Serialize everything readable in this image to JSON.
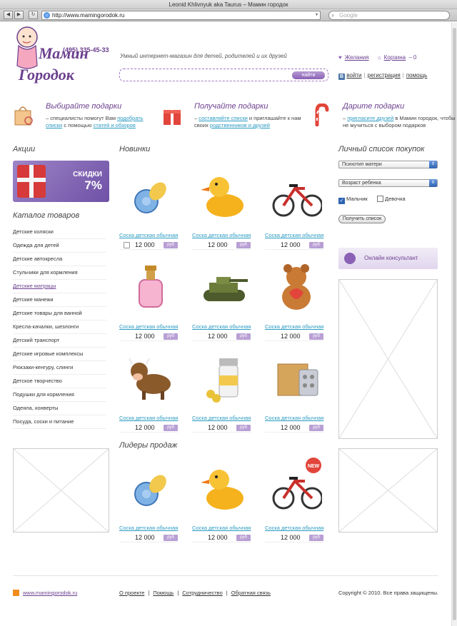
{
  "browser": {
    "title": "Leonid Khlivnyuk aka Taurus – Мамин городок",
    "url": "http://www.mamingorodok.ru",
    "search_placeholder": "Google"
  },
  "header": {
    "logo_line1": "Мамин",
    "logo_line2": "Городок",
    "phone": "(495) 335-45-33",
    "slogan": "Умный интернет-магазин для детей, родителей и их друзей",
    "search_button": "найти",
    "wishlist": "Желания",
    "cart": "Корзина",
    "cart_sep": "–",
    "cart_count": "0",
    "login": "войти",
    "register": "регистрация",
    "help": "помощь"
  },
  "features": [
    {
      "title": "Выбирайте подарки",
      "text_a": "– специалисты помогут Вам ",
      "link_a": "подобрать списки",
      "text_b": " с помощью ",
      "link_b": "статей и обзоров"
    },
    {
      "title": "Получайте подарки",
      "text_a": "– ",
      "link_a": "составляйте списки",
      "text_b": " и приглашайте к нам своих ",
      "link_b": "родственников и друзей"
    },
    {
      "title": "Дарите подарки",
      "text_a": "– ",
      "link_a": "пригласите друзей",
      "text_b": " в Мамин городок, чтобы не мучиться с выбором подарков",
      "link_b": ""
    }
  ],
  "left": {
    "promo_title": "Акции",
    "promo_word": "СКИДКИ",
    "promo_percent": "7%",
    "catalog_title": "Каталог товаров",
    "catalog": [
      "Детские коляски",
      "Одежда для детей",
      "Детские автокресла",
      "Стульчики для кормления",
      "Детские матрацы",
      "Детские манежи",
      "Детские товары для ванной",
      "Кресла-качалки, шезлонги",
      "Детский транспорт",
      "Детские игровые комплексы",
      "Рюкзаки-кенгуру, слинги",
      "Детское творчество",
      "Подушки для кормления",
      "Одеяла, конверты",
      "Посуда, соски и питание"
    ]
  },
  "new_title": "Новинки",
  "leaders_title": "Лидеры продаж",
  "product_name": "Соска детская обычная",
  "product_price": "12 000",
  "product_currency": "руб",
  "new_badge": "NEW",
  "products_new": [
    "pacifier-icon",
    "duck-icon",
    "bicycle-icon",
    "perfume-icon",
    "tank-icon",
    "teddy-bear-icon",
    "cow-icon",
    "pill-bottle-icon",
    "medicine-box-icon"
  ],
  "products_leaders": [
    "pacifier-icon",
    "duck-icon",
    "bicycle-icon"
  ],
  "right": {
    "title": "Личный список покупок",
    "select1": "Психотип матери",
    "select2": "Возраст ребенка",
    "boy": "Мальчик",
    "girl": "Девочка",
    "boy_checked": true,
    "girl_checked": false,
    "button": "Получить список",
    "consult": "Онлайн консультант"
  },
  "footer": {
    "site": "www.mamingorodok.ru",
    "about": "О проекте",
    "help": "Помощь",
    "coop": "Сотрудничество",
    "feedback": "Обратная связь",
    "copyright": "Copyright © 2010. Все права защищены."
  },
  "colors": {
    "brand": "#6b3f8e",
    "link": "#2a9bc2",
    "currency_badge": "#b89fd4"
  }
}
